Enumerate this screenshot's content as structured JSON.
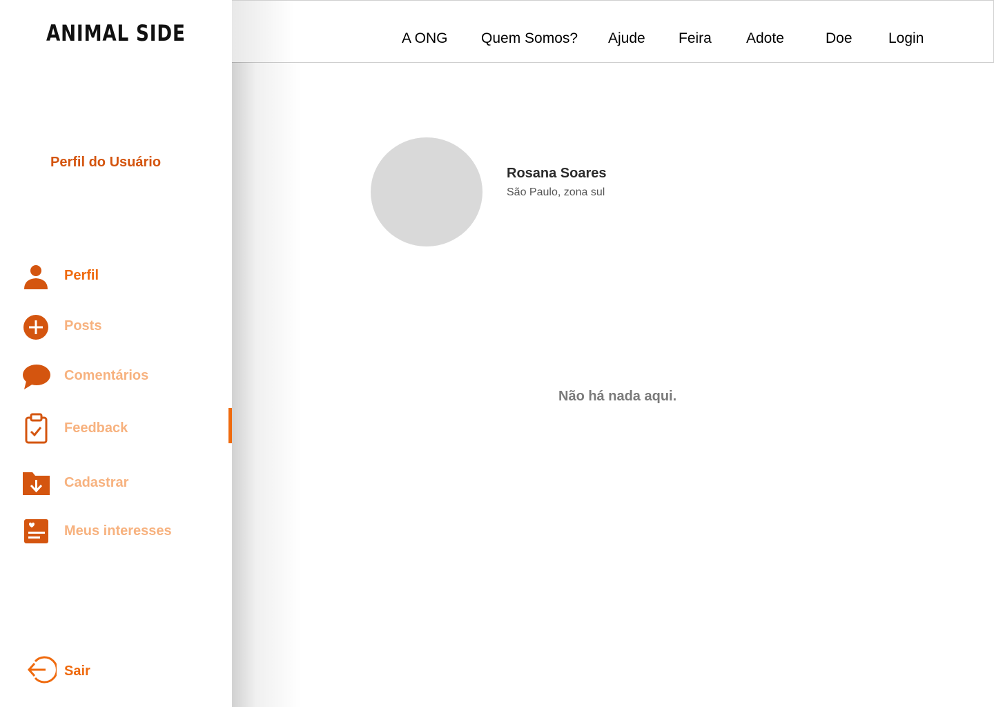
{
  "brand": {
    "logo_text": "ANIMAL SIDE"
  },
  "sidebar": {
    "heading": "Perfil do Usuário",
    "items": [
      {
        "label": "Perfil",
        "icon": "user-icon",
        "active": true
      },
      {
        "label": "Posts",
        "icon": "plus-circle-icon",
        "active": false
      },
      {
        "label": "Comentários",
        "icon": "chat-bubble-icon",
        "active": false
      },
      {
        "label": "Feedback",
        "icon": "clipboard-check-icon",
        "active": false
      },
      {
        "label": "Cadastrar",
        "icon": "folder-download-icon",
        "active": false
      },
      {
        "label": "Meus interesses",
        "icon": "heart-list-icon",
        "active": false
      }
    ],
    "logout_label": "Sair"
  },
  "topnav": {
    "links": [
      "A ONG",
      "Quem Somos?",
      "Ajude",
      "Feira",
      "Adote",
      "Doe",
      "Login"
    ]
  },
  "profile": {
    "name": "Rosana Soares",
    "location": "São Paulo, zona sul"
  },
  "content": {
    "empty_message": "Não há nada aqui."
  },
  "colors": {
    "accent": "#ef6a0e",
    "accent_dark": "#d4550f",
    "inactive": "#f7b27f",
    "avatar_placeholder": "#d9d9d9"
  }
}
